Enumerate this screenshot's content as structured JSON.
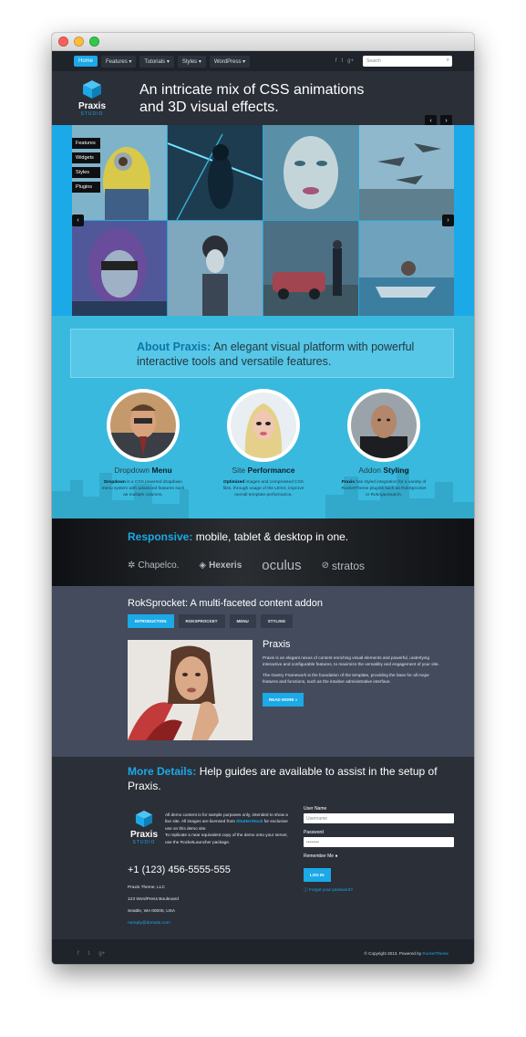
{
  "colors": {
    "accent": "#1ba9e8",
    "dark": "#2b2f38",
    "about_bg": "#39b9de",
    "rok_bg": "#434b5c"
  },
  "nav": {
    "items": [
      "Home",
      "Features ▾",
      "Tutorials ▾",
      "Styles ▾",
      "WordPress ▾"
    ],
    "social_icons": [
      "facebook-icon",
      "twitter-icon",
      "google-plus-icon"
    ],
    "search_placeholder": "Search"
  },
  "header": {
    "brand": "Praxis",
    "studio": "STUDIO",
    "headline": "An intricate mix of CSS animations and 3D visual effects."
  },
  "slider": {
    "side_menu": [
      "Features",
      "Widgets",
      "Styles",
      "Plugins"
    ]
  },
  "about": {
    "title": "About Praxis:",
    "text": "An elegant visual platform with powerful interactive tools and versatile features.",
    "features": [
      {
        "title_plain": "Dropdown",
        "title_bold": "Menu",
        "desc_bold": "Dropdown",
        "desc": " is a CSS powered dropdown menu system with advanced features such as multiple columns."
      },
      {
        "title_plain": "Site",
        "title_bold": "Performance",
        "desc_bold": "Optimized",
        "desc": " images and compressed CSS files, through usage of the LESS, improve overall template performance."
      },
      {
        "title_plain": "Addon",
        "title_bold": "Styling",
        "desc_bold": "Praxis",
        "desc": " has styled integration for a variety of RocketTheme plugins such as RokSprocket or RokAjaxSearch."
      }
    ]
  },
  "responsive": {
    "title_accent": "Responsive:",
    "title_rest": "mobile, tablet & desktop in one.",
    "clients": [
      "Chapelco.",
      "Hexeris",
      "oculus",
      "stratos"
    ]
  },
  "rok": {
    "title": "RokSprocket: A multi-faceted content addon",
    "tabs": [
      "INTRODUCTION",
      "ROKSPROCKET",
      "MENU",
      "STYLING"
    ],
    "heading": "Praxis",
    "p1": "Praxis is an elegant nexus of content enriching visual elements and powerful, underlying interactive and configurable features, to maximize the versatility and engagement of your site.",
    "p2": "The Gantry Framework is the foundation of the template, providing the base for all major features and functions, such as the intuitive administrative interface.",
    "readmore": "READ MORE »"
  },
  "details": {
    "title_accent": "More Details:",
    "title_rest": "Help guides are available to assist in the setup of Praxis.",
    "note_1": "All demo content is for sample purposes only, intended to show a live site. All images are licensed from ",
    "note_link": "ShutterStock",
    "note_2": " for exclusive use on this demo site.",
    "note_3": "To replicate a near equivalent copy of the demo onto your server, use the RocketLauncher package.",
    "phone": "+1 (123) 456-5555-555",
    "company": "Praxis Theme, LLC",
    "street": "123 WordPress Boulevard",
    "city": "Seattle, WA 00000, USA",
    "email": "noreply@domain.com",
    "login": {
      "username_label": "User Name",
      "username_placeholder": "Username",
      "password_label": "Password",
      "password_value": "••••••••",
      "remember": "Remember Me",
      "button": "LOG IN",
      "forgot": "Forgot your password?"
    }
  },
  "footer": {
    "social_icons": [
      "facebook-icon",
      "twitter-icon",
      "google-plus-icon"
    ],
    "copy": "© Copyright 2013. Powered by ",
    "copy_link": "RocketTheme"
  }
}
